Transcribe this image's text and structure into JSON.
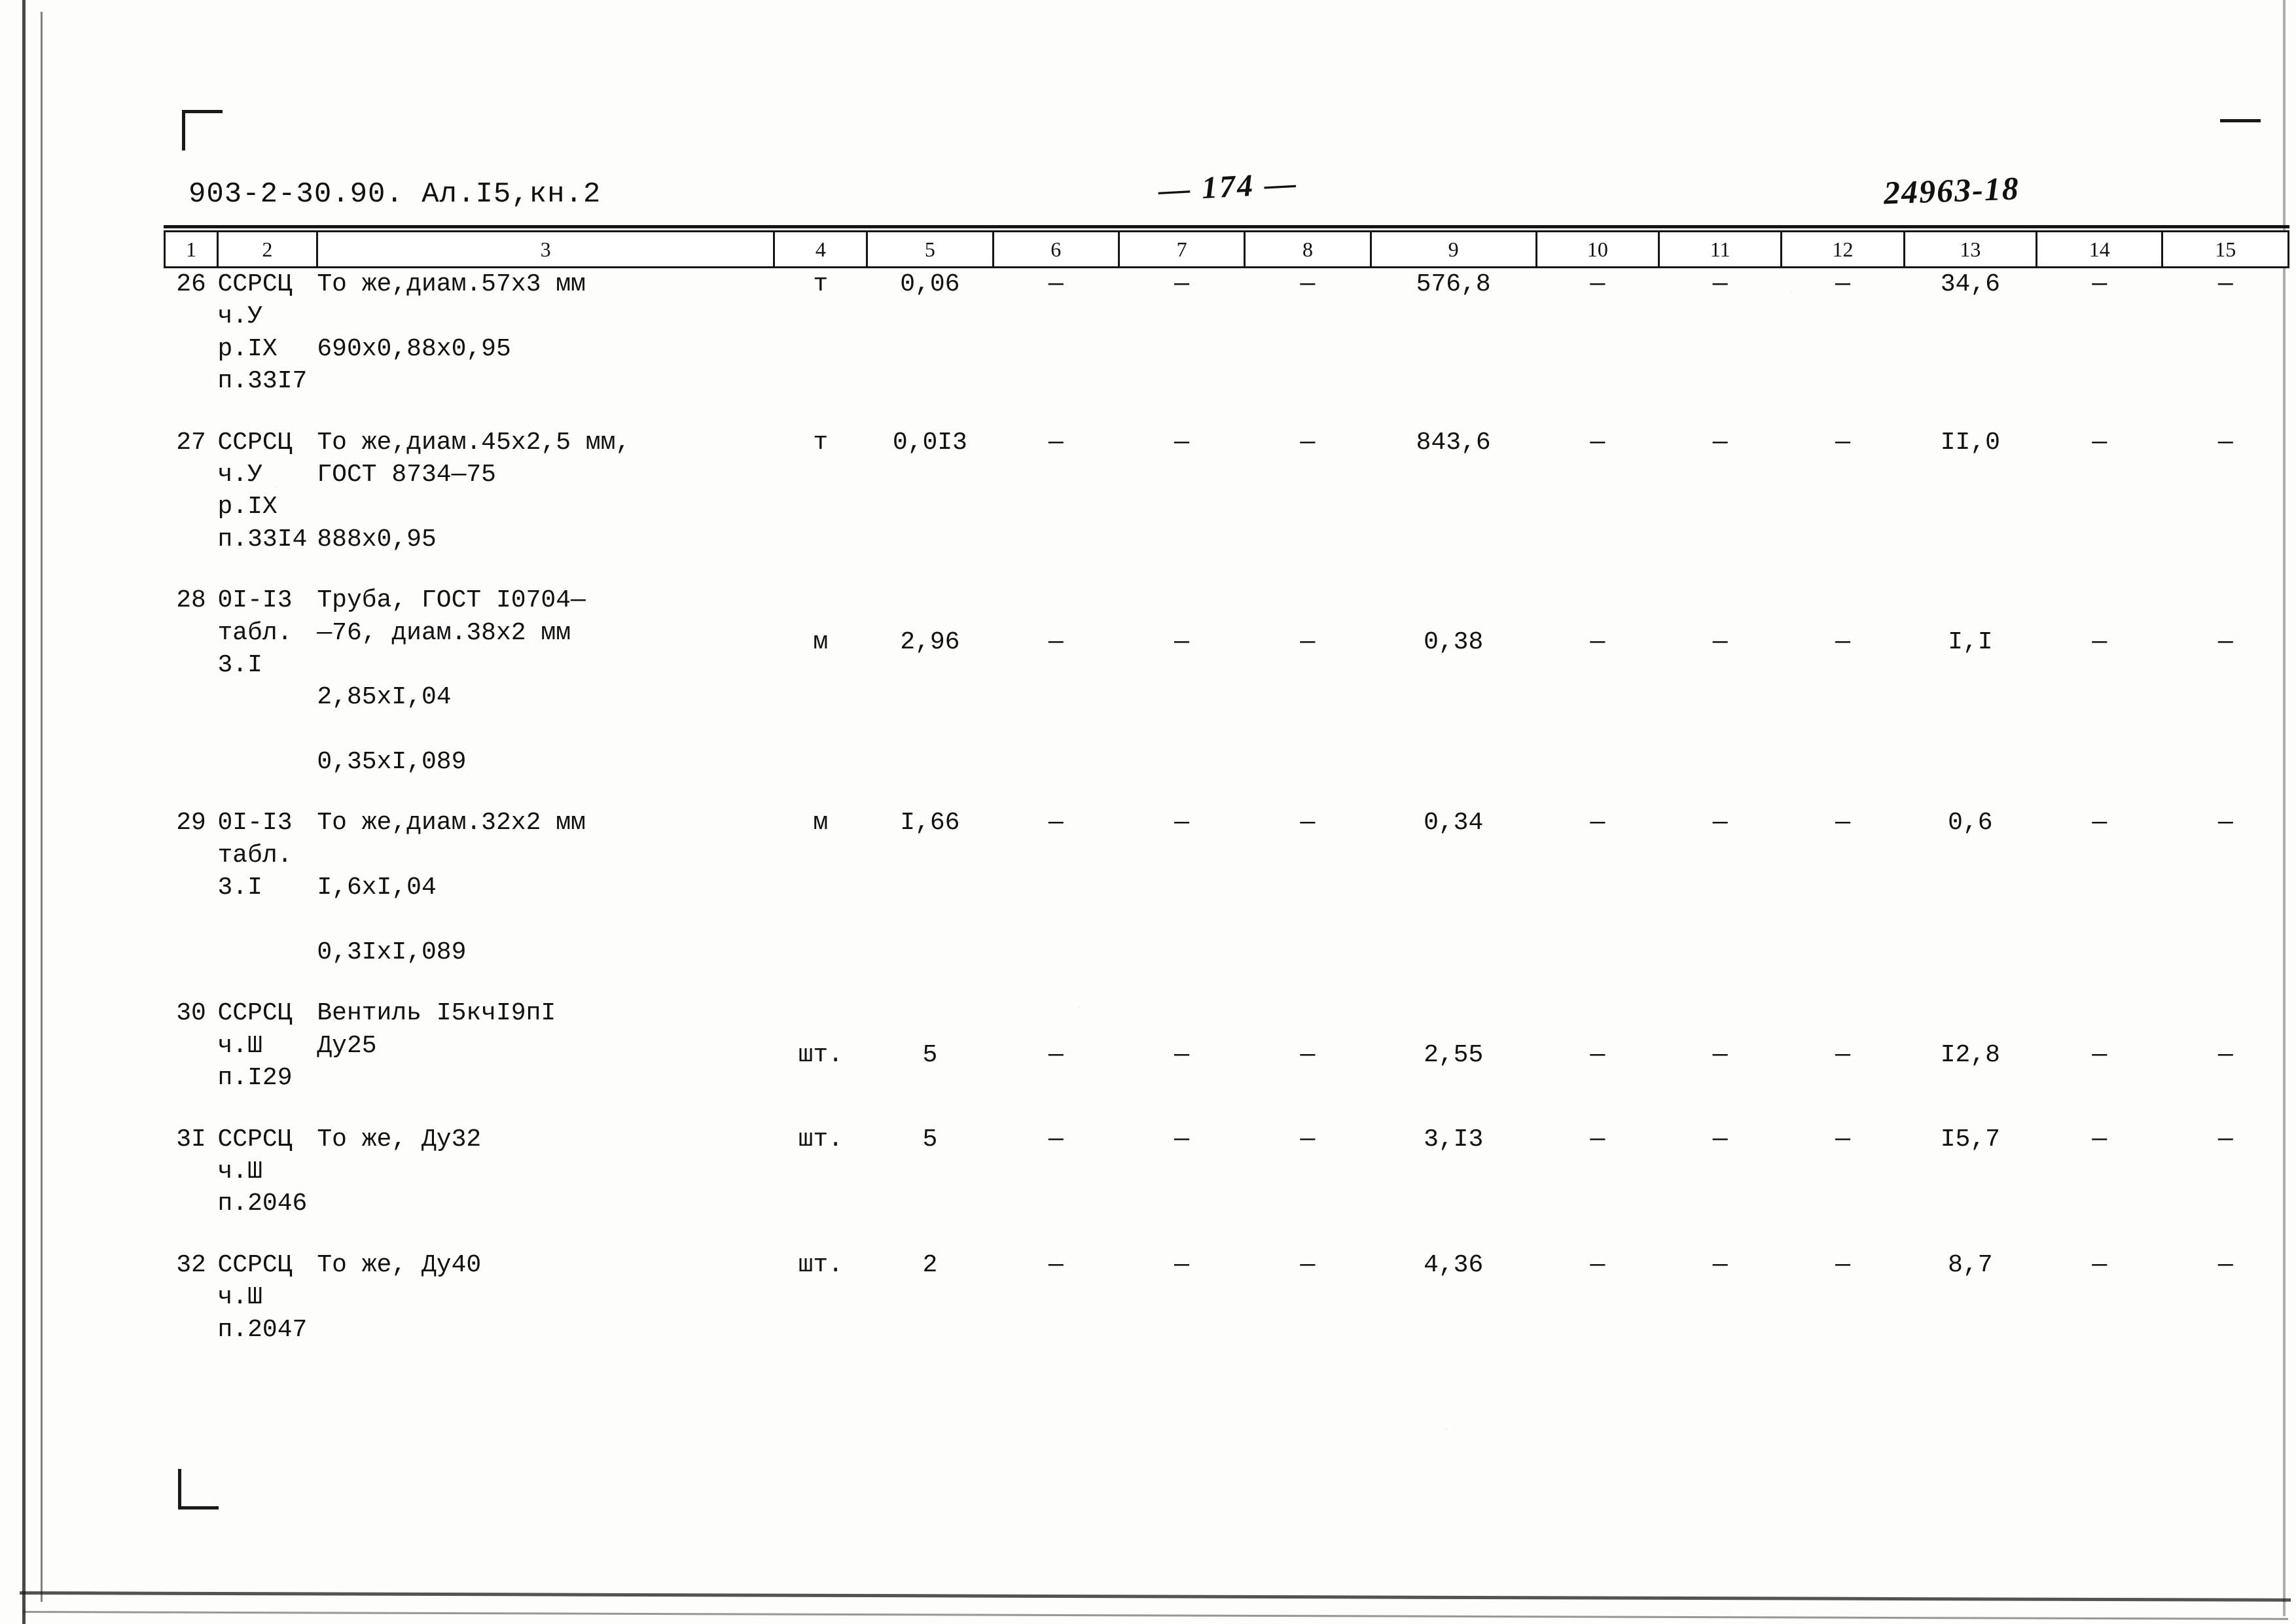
{
  "header": {
    "doc_code": "903-2-30.90. Ал.I5,кн.2",
    "page_number": "— 174 —",
    "archive_number": "24963-18"
  },
  "table": {
    "column_headers": [
      "1",
      "2",
      "3",
      "4",
      "5",
      "6",
      "7",
      "8",
      "9",
      "10",
      "11",
      "12",
      "13",
      "14",
      "15"
    ],
    "dash": "—",
    "rows": [
      {
        "num": "26",
        "code": "ССРСЦ\nч.У\nр.IX\nп.33I7",
        "name": "То же,диам.57х3 мм\n\n690х0,88х0,95",
        "unit": "т",
        "qty": "0,06",
        "c6": "—",
        "c7": "—",
        "c8": "—",
        "c9": "576,8",
        "c10": "—",
        "c11": "—",
        "c12": "—",
        "c13": "34,6",
        "c14": "—",
        "c15": "—"
      },
      {
        "num": "27",
        "code": "ССРСЦ\nч.У\nр.IX\nп.33I4",
        "name": "То же,диам.45х2,5 мм,\nГОСТ 8734—75\n\n888х0,95",
        "unit": "т",
        "qty": "0,0I3",
        "c6": "—",
        "c7": "—",
        "c8": "—",
        "c9": "843,6",
        "c10": "—",
        "c11": "—",
        "c12": "—",
        "c13": "II,0",
        "c14": "—",
        "c15": "—"
      },
      {
        "num": "28",
        "code": "0I-I3\nтабл.\n3.I",
        "name": "Труба, ГОСТ I0704—\n—76, диам.38х2 мм\n\n2,85хI,04\n\n0,35хI,089",
        "unit": "м",
        "qty": "2,96",
        "c6": "—",
        "c7": "—",
        "c8": "—",
        "c9": "0,38",
        "c10": "—",
        "c11": "—",
        "c12": "—",
        "c13": "I,I",
        "c14": "—",
        "c15": "—"
      },
      {
        "num": "29",
        "code": "0I-I3\nтабл.\n3.I",
        "name": "То же,диам.32х2 мм\n\nI,6хI,04\n\n0,3IхI,089",
        "unit": "м",
        "qty": "I,66",
        "c6": "—",
        "c7": "—",
        "c8": "—",
        "c9": "0,34",
        "c10": "—",
        "c11": "—",
        "c12": "—",
        "c13": "0,6",
        "c14": "—",
        "c15": "—"
      },
      {
        "num": "30",
        "code": "ССРСЦ\nч.Ш\nп.I29",
        "name": "Вентиль I5кчI9пI\nДу25",
        "unit": "шт.",
        "qty": "5",
        "c6": "—",
        "c7": "—",
        "c8": "—",
        "c9": "2,55",
        "c10": "—",
        "c11": "—",
        "c12": "—",
        "c13": "I2,8",
        "c14": "—",
        "c15": "—"
      },
      {
        "num": "3I",
        "code": "ССРСЦ\nч.Ш\nп.2046",
        "name": "То же, Ду32",
        "unit": "шт.",
        "qty": "5",
        "c6": "—",
        "c7": "—",
        "c8": "—",
        "c9": "3,I3",
        "c10": "—",
        "c11": "—",
        "c12": "—",
        "c13": "I5,7",
        "c14": "—",
        "c15": "—"
      },
      {
        "num": "32",
        "code": "ССРСЦ\nч.Ш\nп.2047",
        "name": "То же, Ду40",
        "unit": "шт.",
        "qty": "2",
        "c6": "—",
        "c7": "—",
        "c8": "—",
        "c9": "4,36",
        "c10": "—",
        "c11": "—",
        "c12": "—",
        "c13": "8,7",
        "c14": "—",
        "c15": "—"
      }
    ]
  }
}
